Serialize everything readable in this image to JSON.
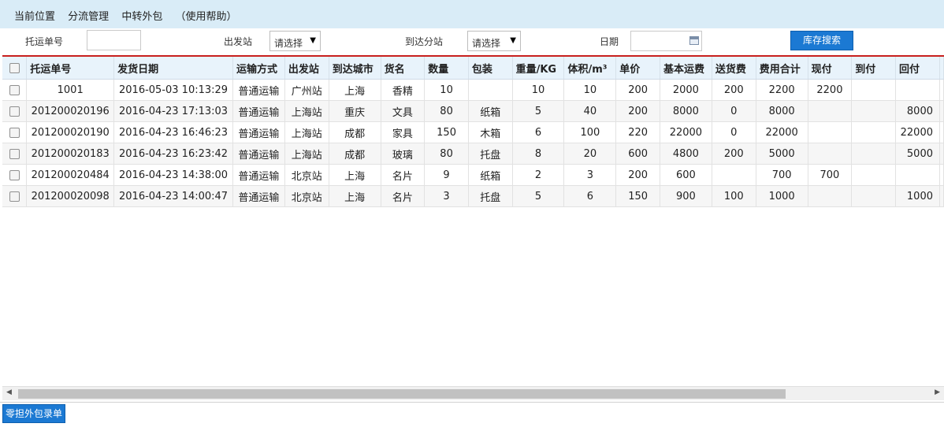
{
  "breadcrumb": [
    "当前位置",
    "分流管理",
    "中转外包",
    "（使用帮助）"
  ],
  "filters": {
    "consign_no_label": "托运单号",
    "consign_no_value": "",
    "origin_label": "出发站",
    "origin_value": "请选择",
    "dest_label": "到达分站",
    "dest_value": "请选择",
    "date_label": "日期",
    "date_value": "",
    "search_button": "库存搜索"
  },
  "table": {
    "columns": [
      "托运单号",
      "发货日期",
      "运输方式",
      "出发站",
      "到达城市",
      "货名",
      "数量",
      "包装",
      "重量/KG",
      "体积/m³",
      "单价",
      "基本运费",
      "送货费",
      "费用合计",
      "现付",
      "到付",
      "回付"
    ],
    "rows": [
      [
        "1001",
        "2016-05-03 10:13:29",
        "普通运输",
        "广州站",
        "上海",
        "香精",
        "10",
        "",
        "10",
        "10",
        "200",
        "2000",
        "200",
        "2200",
        "2200",
        "",
        ""
      ],
      [
        "201200020196",
        "2016-04-23 17:13:03",
        "普通运输",
        "上海站",
        "重庆",
        "文具",
        "80",
        "纸箱",
        "5",
        "40",
        "200",
        "8000",
        "0",
        "8000",
        "",
        "",
        "8000"
      ],
      [
        "201200020190",
        "2016-04-23 16:46:23",
        "普通运输",
        "上海站",
        "成都",
        "家具",
        "150",
        "木箱",
        "6",
        "100",
        "220",
        "22000",
        "0",
        "22000",
        "",
        "",
        "22000"
      ],
      [
        "201200020183",
        "2016-04-23 16:23:42",
        "普通运输",
        "上海站",
        "成都",
        "玻璃",
        "80",
        "托盘",
        "8",
        "20",
        "600",
        "4800",
        "200",
        "5000",
        "",
        "",
        "5000"
      ],
      [
        "201200020484",
        "2016-04-23 14:38:00",
        "普通运输",
        "北京站",
        "上海",
        "名片",
        "9",
        "纸箱",
        "2",
        "3",
        "200",
        "600",
        "",
        "700",
        "700",
        "",
        ""
      ],
      [
        "201200020098",
        "2016-04-23 14:00:47",
        "普通运输",
        "北京站",
        "上海",
        "名片",
        "3",
        "托盘",
        "5",
        "6",
        "150",
        "900",
        "100",
        "1000",
        "",
        "",
        "1000"
      ]
    ]
  },
  "footer": {
    "outsource_button": "零担外包录单"
  },
  "colors": {
    "accent": "#1b79d3",
    "header_bg": "#d9ecf7",
    "divider": "#c8201e"
  },
  "icons": [
    "calendar-icon",
    "dropdown-arrow-icon",
    "scroll-left-icon",
    "scroll-right-icon"
  ]
}
